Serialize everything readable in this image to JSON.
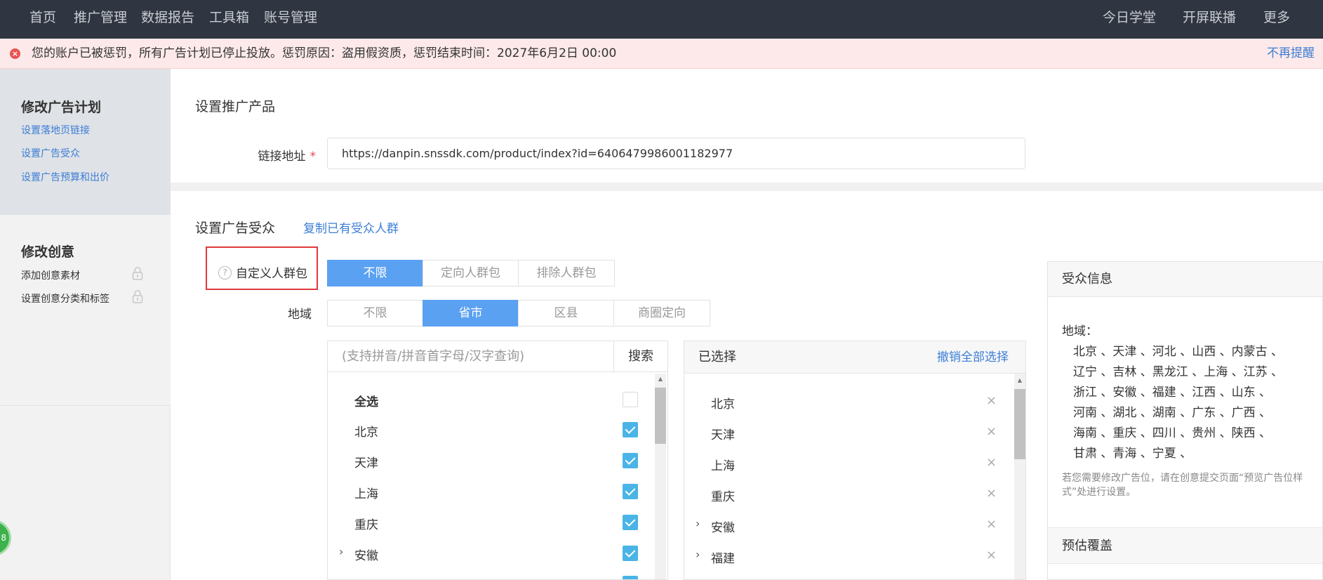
{
  "topnav": {
    "left_items": [
      "首页",
      "推广管理",
      "数据报告",
      "工具箱",
      "账号管理"
    ],
    "right_items": [
      "今日学堂",
      "开屏联播",
      "更多"
    ]
  },
  "alert": {
    "message": "您的账户已被惩罚，所有广告计划已停止投放。惩罚原因：盗用假资质，惩罚结束时间：2027年6月2日 00:00",
    "dismiss": "不再提醒",
    "color": "#fde9e9"
  },
  "sidebar": {
    "plan_title": "修改广告计划",
    "plan_links": [
      "设置落地页链接",
      "设置广告受众",
      "设置广告预算和出价"
    ],
    "creative_title": "修改创意",
    "creative_items": [
      "添加创意素材",
      "设置创意分类和标签"
    ]
  },
  "product": {
    "title": "设置推广产品",
    "link_label": "链接地址",
    "required_mark": "*",
    "link_value": "https://danpin.snssdk.com/product/index?id=6406479986001182977"
  },
  "audience": {
    "title": "设置广告受众",
    "copy_link": "复制已有受众人群",
    "custom_label": "自定义人群包",
    "help_icon": "question-circle-icon",
    "custom_options": [
      "不限",
      "定向人群包",
      "排除人群包"
    ],
    "custom_selected": 0,
    "region_label": "地域",
    "region_options": [
      "不限",
      "省市",
      "区县",
      "商圈定向"
    ],
    "region_selected": 1,
    "accent": "#5ba1f2"
  },
  "province_list": {
    "search_placeholder": "(支持拼音/拼音首字母/汉字查询)",
    "search_button": "搜索",
    "select_all": "全选",
    "rows": [
      {
        "name": "北京",
        "expandable": false,
        "checked": true
      },
      {
        "name": "天津",
        "expandable": false,
        "checked": true
      },
      {
        "name": "上海",
        "expandable": false,
        "checked": true
      },
      {
        "name": "重庆",
        "expandable": false,
        "checked": true
      },
      {
        "name": "安徽",
        "expandable": true,
        "checked": true
      }
    ]
  },
  "selected": {
    "title": "已选择",
    "clear_all": "撤销全部选择",
    "remove_glyph": "×",
    "rows": [
      {
        "name": "北京",
        "expandable": false
      },
      {
        "name": "天津",
        "expandable": false
      },
      {
        "name": "上海",
        "expandable": false
      },
      {
        "name": "重庆",
        "expandable": false
      },
      {
        "name": "安徽",
        "expandable": true
      },
      {
        "name": "福建",
        "expandable": true
      }
    ]
  },
  "info": {
    "title": "受众信息",
    "region_label": "地域：",
    "region_lines": [
      "北京 、天津 、河北 、山西 、内蒙古 、",
      "辽宁 、吉林 、黑龙江 、上海 、江苏 、",
      "浙江 、安徽 、福建 、江西 、山东 、",
      "河南 、湖北 、湖南 、广东 、广西 、",
      "海南 、重庆 、四川 、贵州 、陕西 、",
      "甘肃 、青海 、宁夏 、"
    ],
    "note": "若您需要修改广告位，请在创意提交页面“预览广告位样式”处进行设置。",
    "coverage_title": "预估覆盖"
  },
  "floating_badge": "8"
}
